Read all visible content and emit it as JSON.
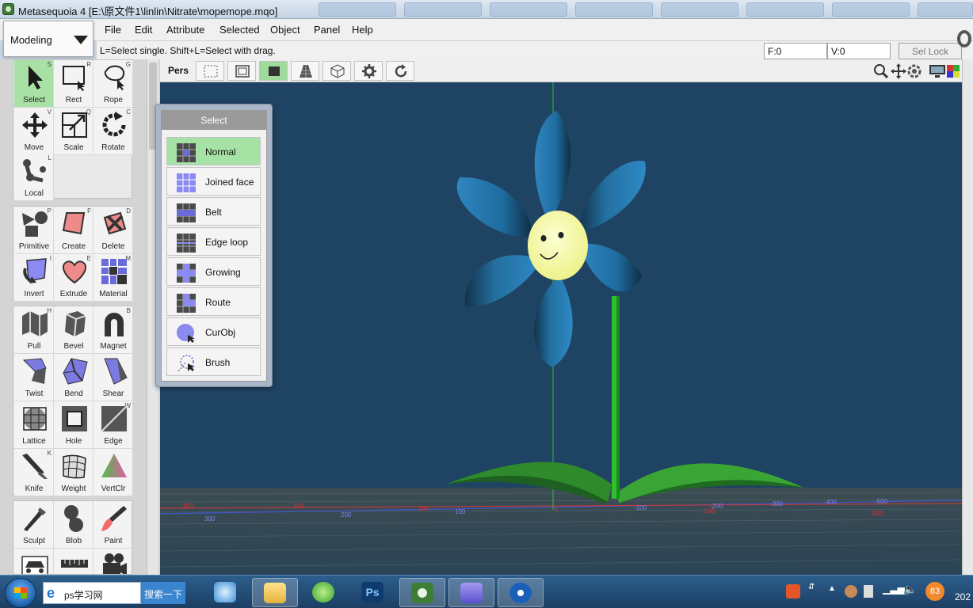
{
  "window": {
    "title": "Metasequoia 4 [E:\\原文件1\\linlin\\Nitrate\\mopemope.mqo]"
  },
  "mode_select": {
    "value": "Modeling",
    "icon": "chevron-down-icon"
  },
  "menu": {
    "items": [
      "File",
      "Edit",
      "Attribute",
      "Selected",
      "Object",
      "Panel",
      "Help"
    ]
  },
  "status": {
    "hint": "L=Select single.  Shift+L=Select with drag.",
    "faces": "F:0",
    "vertices": "V:0",
    "sel_lock": "Sel Lock"
  },
  "tools": {
    "group1": [
      {
        "label": "Select",
        "key": "S",
        "icon": "arrow-cursor-icon",
        "active": true
      },
      {
        "label": "Rect",
        "key": "R",
        "icon": "rect-select-icon"
      },
      {
        "label": "Rope",
        "key": "G",
        "icon": "lasso-icon"
      },
      {
        "label": "Move",
        "key": "V",
        "icon": "move-icon"
      },
      {
        "label": "Scale",
        "key": "Q",
        "icon": "scale-icon"
      },
      {
        "label": "Rotate",
        "key": "C",
        "icon": "rotate-icon"
      },
      {
        "label": "Local",
        "key": "L",
        "icon": "local-axis-icon"
      }
    ],
    "group2": [
      {
        "label": "Primitive",
        "key": "P",
        "icon": "primitive-icon"
      },
      {
        "label": "Create",
        "key": "F",
        "icon": "create-face-icon"
      },
      {
        "label": "Delete",
        "key": "D",
        "icon": "delete-icon"
      },
      {
        "label": "Invert",
        "key": "I",
        "icon": "invert-icon"
      },
      {
        "label": "Extrude",
        "key": "E",
        "icon": "extrude-icon"
      },
      {
        "label": "Material",
        "key": "M",
        "icon": "material-icon"
      }
    ],
    "group3": [
      {
        "label": "Pull",
        "key": "H",
        "icon": "pull-icon"
      },
      {
        "label": "Bevel",
        "key": "",
        "icon": "bevel-icon"
      },
      {
        "label": "Magnet",
        "key": "B",
        "icon": "magnet-icon"
      },
      {
        "label": "Twist",
        "key": "",
        "icon": "twist-icon"
      },
      {
        "label": "Bend",
        "key": "",
        "icon": "bend-icon"
      },
      {
        "label": "Shear",
        "key": "",
        "icon": "shear-icon"
      },
      {
        "label": "Lattice",
        "key": "",
        "icon": "lattice-icon"
      },
      {
        "label": "Hole",
        "key": "",
        "icon": "hole-icon"
      },
      {
        "label": "Edge",
        "key": "W",
        "icon": "edge-icon"
      },
      {
        "label": "Knife",
        "key": "K",
        "icon": "knife-icon"
      },
      {
        "label": "Weight",
        "key": "",
        "icon": "weight-icon"
      },
      {
        "label": "VertClr",
        "key": "",
        "icon": "vertex-color-icon"
      }
    ],
    "group4": [
      {
        "label": "Sculpt",
        "key": "",
        "icon": "sculpt-icon"
      },
      {
        "label": "Blob",
        "key": "",
        "icon": "blob-icon"
      },
      {
        "label": "Paint",
        "key": "",
        "icon": "paint-brush-icon"
      },
      {
        "label": "",
        "key": "",
        "icon": "car-icon"
      },
      {
        "label": "",
        "key": "",
        "icon": "ruler-icon"
      },
      {
        "label": "",
        "key": "",
        "icon": "camera-icon"
      }
    ]
  },
  "viewport_toolbar": {
    "view_label": "Pers",
    "buttons": [
      "wireframe-rect-icon",
      "wire-icon",
      "solid-icon",
      "texture-icon",
      "cube-grid-icon",
      "gear-icon",
      "refresh-icon"
    ]
  },
  "viewport": {
    "background": "#1f4362",
    "axis_ticks_red": [
      "300",
      "200",
      "100",
      "0",
      "-100",
      "-200",
      "-300",
      "-400",
      "-500",
      "-600"
    ],
    "axis_ticks_blue": [
      "300",
      "200",
      "100",
      "-100",
      "-200",
      "-300",
      "-400",
      "-500"
    ],
    "grid_labels_red_lower": [
      "0",
      "-200",
      "-200",
      "-300"
    ]
  },
  "select_panel": {
    "title": "Select",
    "options": [
      {
        "label": "Normal",
        "icon": "normal-select-icon",
        "active": true
      },
      {
        "label": "Joined face",
        "icon": "joined-face-icon"
      },
      {
        "label": "Belt",
        "icon": "belt-icon"
      },
      {
        "label": "Edge loop",
        "icon": "edge-loop-icon"
      },
      {
        "label": "Growing",
        "icon": "growing-icon"
      },
      {
        "label": "Route",
        "icon": "route-icon"
      },
      {
        "label": "CurObj",
        "icon": "current-object-icon"
      },
      {
        "label": "Brush",
        "icon": "brush-select-icon"
      }
    ]
  },
  "taskbar": {
    "search_text": "ps学习网",
    "search_button": "搜索一下",
    "tray_badge": "83",
    "clock": "202"
  }
}
